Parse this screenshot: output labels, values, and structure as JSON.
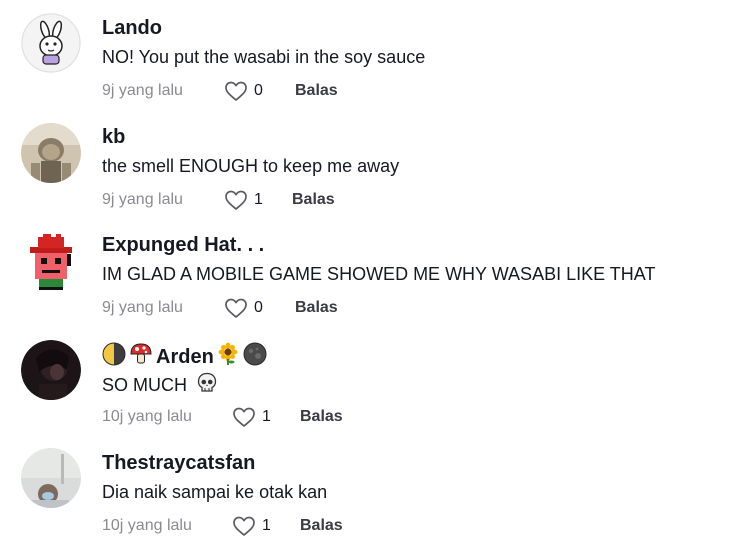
{
  "comments": [
    {
      "username": "Lando",
      "text": "NO! You put the wasabi in the soy sauce",
      "time": "9j yang lalu",
      "likes": "0",
      "reply_label": "Balas"
    },
    {
      "username": "kb",
      "text": "the smell ENOUGH to keep me away",
      "time": "9j yang lalu",
      "likes": "1",
      "reply_label": "Balas"
    },
    {
      "username": "Expunged Hat. . .",
      "text": "IM GLAD A MOBILE GAME SHOWED ME WHY WASABI LIKE THAT",
      "time": "9j yang lalu",
      "likes": "0",
      "reply_label": "Balas"
    },
    {
      "username": "Arden",
      "text": "SO MUCH",
      "time": "10j yang lalu",
      "likes": "1",
      "reply_label": "Balas"
    },
    {
      "username": "Thestraycatsfan",
      "text": "Dia naik sampai ke otak kan",
      "time": "10j yang lalu",
      "likes": "1",
      "reply_label": "Balas"
    }
  ],
  "icons": {
    "like": "heart-outline-icon",
    "arden_name_emojis": [
      "first-quarter-moon-icon",
      "mushroom-icon",
      "sunflower-icon",
      "full-moon-icon"
    ],
    "arden_text_emoji": "skull-icon"
  },
  "colors": {
    "text_primary": "#161823",
    "text_secondary": "#8a8b91"
  }
}
